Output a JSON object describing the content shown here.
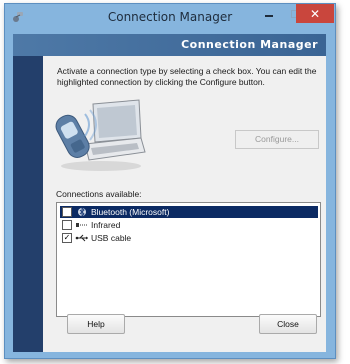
{
  "window": {
    "title": "Connection Manager",
    "close_glyph": "✕"
  },
  "banner": {
    "title": "Connection Manager"
  },
  "main": {
    "instructions": "Activate a connection type by selecting a check box. You can edit the highlighted connection by clicking the Configure button.",
    "configure_label": "Configure...",
    "connections_label": "Connections available:",
    "connections": [
      {
        "label": "Bluetooth (Microsoft)",
        "checked": false,
        "selected": true,
        "icon": "bluetooth-icon"
      },
      {
        "label": "Infrared",
        "checked": false,
        "selected": false,
        "icon": "infrared-icon"
      },
      {
        "label": "USB cable",
        "checked": true,
        "selected": false,
        "icon": "usb-icon"
      }
    ]
  },
  "footer": {
    "help_label": "Help",
    "close_label": "Close"
  },
  "colors": {
    "titlebar": "#86b5de",
    "banner": "#3a6494",
    "left_strip": "#233f6b",
    "selection": "#0b2a63",
    "close_button": "#c9463d"
  }
}
